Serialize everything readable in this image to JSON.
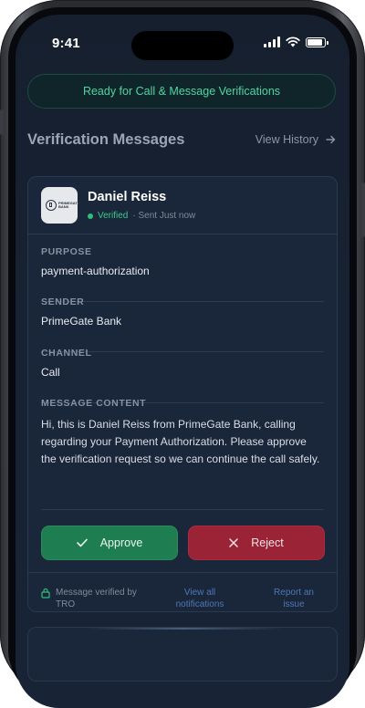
{
  "status_bar": {
    "time": "9:41",
    "battery_level": 1.0
  },
  "banner": {
    "text": "Ready for Call & Message Verifications"
  },
  "section": {
    "title": "Verification Messages",
    "history_link": "View History",
    "history_icon": "arrow-right-icon"
  },
  "message": {
    "logo_text": "PRIMEGATE BANK",
    "sender_name": "Daniel Reiss",
    "verified_label": "Verified",
    "sent_label": "· Sent Just now",
    "fields": [
      {
        "label": "PURPOSE",
        "value": "payment-authorization"
      },
      {
        "label": "SENDER",
        "value": "PrimeGate Bank"
      },
      {
        "label": "CHANNEL",
        "value": "Call"
      }
    ],
    "content_label": "MESSAGE CONTENT",
    "content": "Hi, this is Daniel Reiss from PrimeGate Bank, calling regarding your Payment Authorization. Please approve the verification request so we can continue the call safely."
  },
  "actions": {
    "approve_label": "Approve",
    "reject_label": "Reject"
  },
  "footer": {
    "verified_by": "Message verified by TRO",
    "view_all": "View all notifications",
    "report": "Report an issue"
  },
  "colors": {
    "accent_green": "#1f7d52",
    "accent_red": "#9a2336",
    "banner_text": "#4fd5a2",
    "link": "#4d78b8"
  }
}
